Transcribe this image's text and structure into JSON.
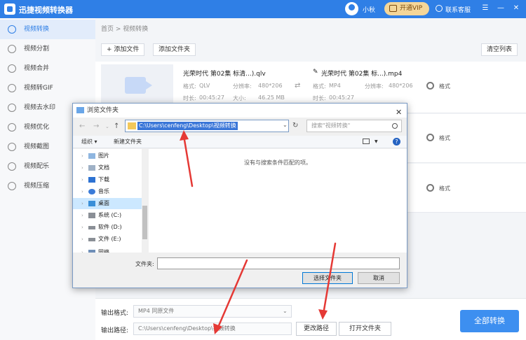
{
  "app": {
    "title": "迅捷视频转换器",
    "username": "小秋",
    "vip_label": "开通VIP",
    "support_label": "联系客服"
  },
  "sidebar": {
    "items": [
      {
        "label": "视频转换"
      },
      {
        "label": "视频分割"
      },
      {
        "label": "视频合并"
      },
      {
        "label": "视频转GIF"
      },
      {
        "label": "视频去水印"
      },
      {
        "label": "视频优化"
      },
      {
        "label": "视频截图"
      },
      {
        "label": "视频配乐"
      },
      {
        "label": "视频压缩"
      }
    ]
  },
  "main": {
    "breadcrumb": "首页 > 视频转换",
    "add_file": "+ 添加文件",
    "add_folder": "添加文件夹",
    "clear_list": "清空列表",
    "file": {
      "src_name": "光荣时代 第02集 标清...).qlv",
      "dst_name": "光荣时代 第02集 标...).mp4",
      "src_fmt_label": "格式:",
      "src_fmt": "QLV",
      "src_res_label": "分辨率:",
      "src_res": "480*206",
      "src_dur_label": "时长:",
      "src_dur": "00:45:27",
      "src_size_label": "大小:",
      "src_size": "46.25 MB",
      "dst_fmt_label": "格式:",
      "dst_fmt": "MP4",
      "dst_res_label": "分辨率:",
      "dst_res": "480*206",
      "dst_dur_label": "时长:",
      "dst_dur": "00:45:27",
      "settings_label": "格式"
    },
    "row2_settings": "格式",
    "row3_settings": "格式"
  },
  "bottom": {
    "output_format_label": "输出格式:",
    "output_format_value": "MP4  同原文件",
    "output_path_label": "输出路径:",
    "output_path_value": "C:\\Users\\cenfeng\\Desktop\\视频转换",
    "change_path": "更改路径",
    "open_folder": "打开文件夹",
    "convert_all": "全部转换"
  },
  "dialog": {
    "title": "浏览文件夹",
    "address": "C:\\Users\\cenfeng\\Desktop\\视频转换",
    "search_placeholder": "搜索\"视频转换\"",
    "organize": "组织 ▾",
    "new_folder": "新建文件夹",
    "help": "?",
    "tree": [
      {
        "label": "图片"
      },
      {
        "label": "文档"
      },
      {
        "label": "下载"
      },
      {
        "label": "音乐"
      },
      {
        "label": "桌面"
      },
      {
        "label": "系统 (C:)"
      },
      {
        "label": "软件 (D:)"
      },
      {
        "label": "文件 (E:)"
      },
      {
        "label": "网络"
      }
    ],
    "empty_message": "没有与搜索条件匹配的项。",
    "folder_label": "文件夹:",
    "folder_value": "",
    "select_button": "选择文件夹",
    "cancel_button": "取消"
  },
  "colors": {
    "accent": "#2f7fe6",
    "annotation": "#e53935"
  }
}
